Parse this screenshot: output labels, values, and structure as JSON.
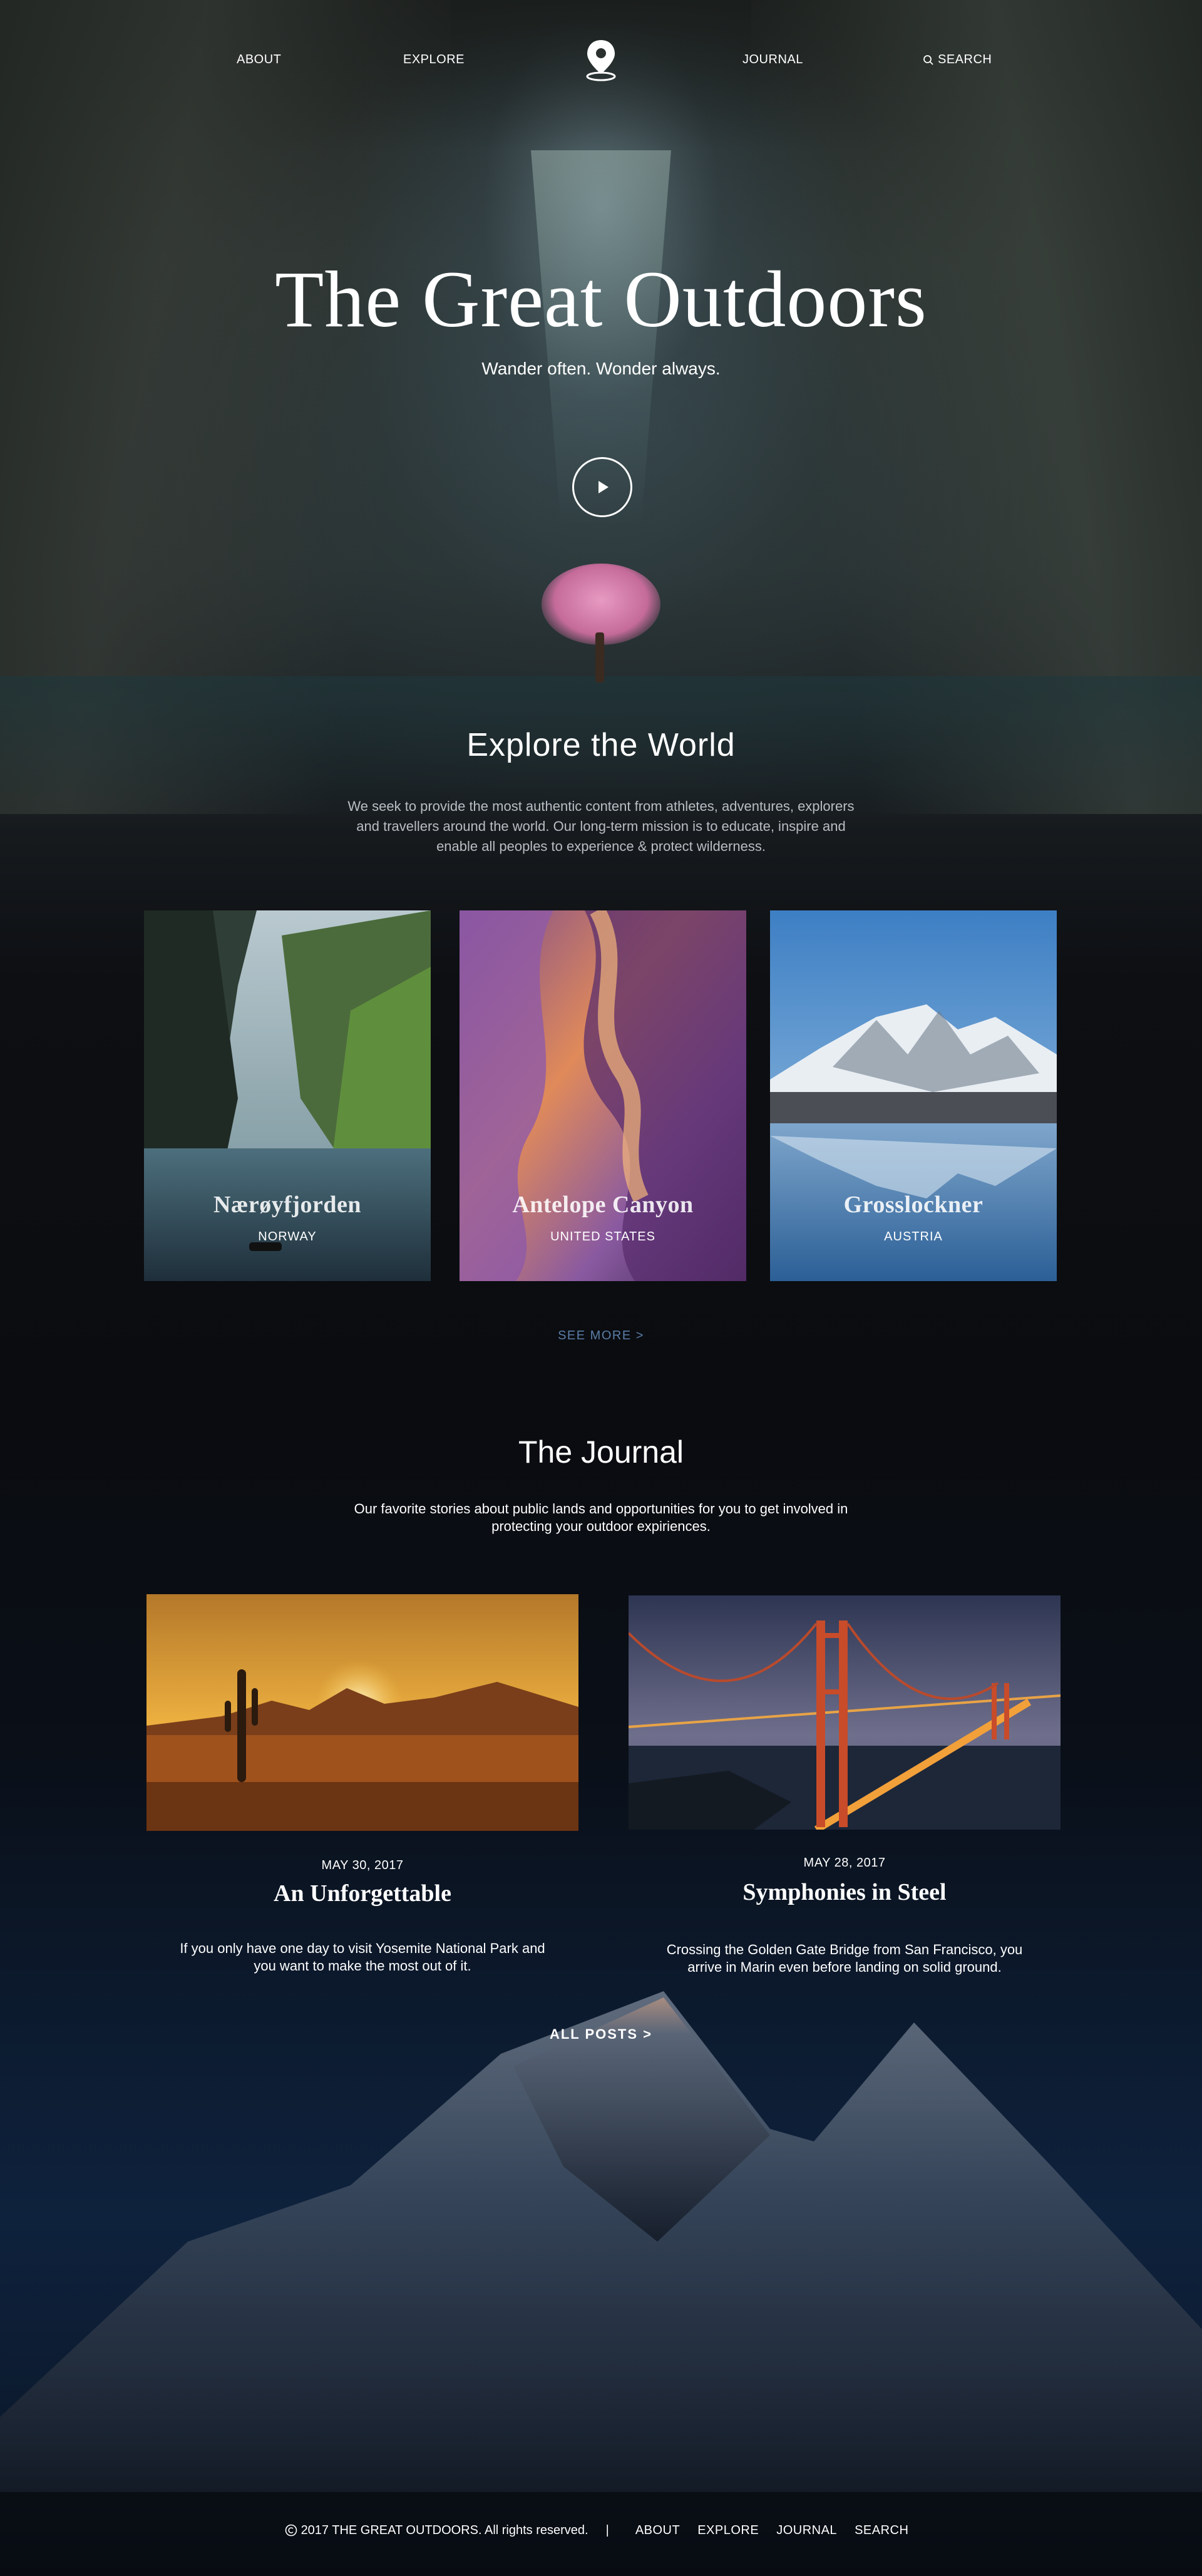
{
  "nav": {
    "about": "ABOUT",
    "explore": "EXPLORE",
    "journal": "JOURNAL",
    "search": "SEARCH"
  },
  "hero": {
    "title": "The Great Outdoors",
    "subtitle": "Wander often. Wonder always."
  },
  "explore": {
    "title": "Explore the World",
    "description": "We seek to provide the most authentic content from athletes, adventures, explorers and travellers around the world. Our long-term mission is to educate, inspire and enable all peoples to experience & protect wilderness.",
    "destinations": [
      {
        "name": "Nærøyfjorden",
        "country": "NORWAY"
      },
      {
        "name": "Antelope Canyon",
        "country": "UNITED STATES"
      },
      {
        "name": "Grosslockner",
        "country": "AUSTRIA"
      }
    ],
    "see_more": "SEE MORE  >"
  },
  "journal": {
    "title": "The Journal",
    "description": "Our favorite stories about public lands and opportunities for you to get involved in protecting your outdoor expiriences.",
    "posts": [
      {
        "date": "MAY 30, 2017",
        "title": "An Unforgettable",
        "excerpt": "If you only have one day to visit Yosemite National Park and you want to make the most out of it."
      },
      {
        "date": "MAY 28, 2017",
        "title": "Symphonies in Steel",
        "excerpt": "Crossing the Golden Gate Bridge from San Francisco, you arrive in Marin even before landing on solid ground."
      }
    ],
    "all_posts": "ALL POSTS >"
  },
  "footer": {
    "copyright": "2017 THE GREAT OUTDOORS. All rights reserved.",
    "separator": "|",
    "links": [
      "ABOUT",
      "EXPLORE",
      "JOURNAL",
      "SEARCH"
    ]
  },
  "colors": {
    "accent_link": "#5b7da6",
    "text": "#ffffff",
    "muted_text": "#b9bec4"
  },
  "icons": {
    "logo": "map-pin-icon",
    "search": "search-icon",
    "play": "play-icon",
    "copyright": "copyright-icon"
  }
}
